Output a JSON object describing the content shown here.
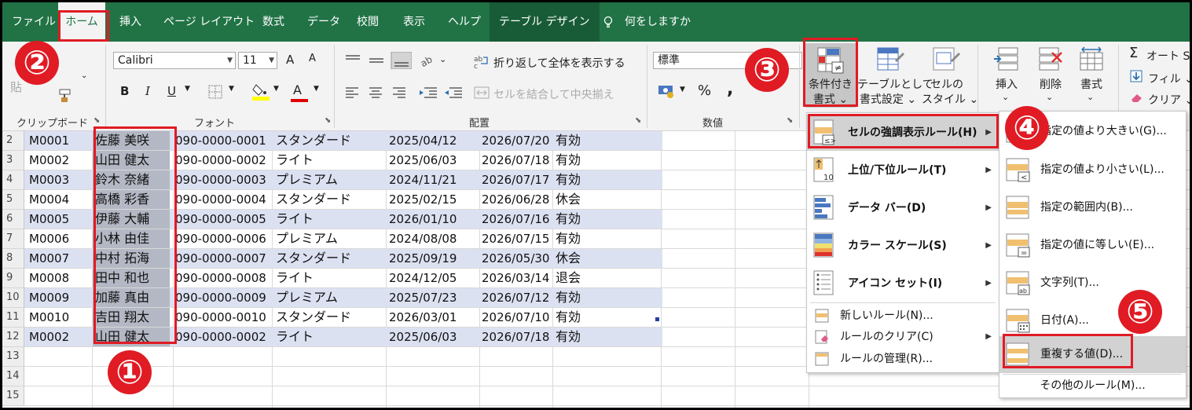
{
  "tabs": [
    "ファイル",
    "ホーム",
    "挿入",
    "ページ レイアウト",
    "数式",
    "データ",
    "校閲",
    "表示",
    "ヘルプ",
    "テーブル デザイン"
  ],
  "tell_me": "何をしますか",
  "ribbon": {
    "groups": {
      "clipboard": "クリップボード",
      "font": "フォント",
      "alignment": "配置",
      "number": "数値"
    },
    "font_name": "Calibri",
    "font_size": "11",
    "number_format": "標準",
    "wrap_text": "折り返して全体を表示する",
    "merge_center": "セルを結合して中央揃え",
    "paste_partial": "貼",
    "bold": "B",
    "italic": "I",
    "underline": "U",
    "font_grow": "A",
    "font_shrink": "A",
    "percent": "%",
    "comma": ",",
    "conditional_format": [
      "条件付き",
      "書式"
    ],
    "format_as_table": [
      "テーブルとして",
      "書式設定"
    ],
    "cell_styles": [
      "セルの",
      "スタイル"
    ],
    "insert": "挿入",
    "delete": "削除",
    "format": "書式",
    "autosum": "オート S",
    "fill": "フィル",
    "clear": "クリア"
  },
  "rows": [
    {
      "n": "2",
      "id": "M0001",
      "name": "佐藤 美咲",
      "phone": "090-0000-0001",
      "plan": "スタンダード",
      "start": "2025/04/12",
      "end": "2026/07/20",
      "status": "有効"
    },
    {
      "n": "3",
      "id": "M0002",
      "name": "山田 健太",
      "phone": "090-0000-0002",
      "plan": "ライト",
      "start": "2025/06/03",
      "end": "2026/07/18",
      "status": "有効"
    },
    {
      "n": "4",
      "id": "M0003",
      "name": "鈴木 奈緒",
      "phone": "090-0000-0003",
      "plan": "プレミアム",
      "start": "2024/11/21",
      "end": "2026/07/17",
      "status": "有効"
    },
    {
      "n": "5",
      "id": "M0004",
      "name": "高橋 彩香",
      "phone": "090-0000-0004",
      "plan": "スタンダード",
      "start": "2025/02/15",
      "end": "2026/06/28",
      "status": "休会"
    },
    {
      "n": "6",
      "id": "M0005",
      "name": "伊藤 大輔",
      "phone": "090-0000-0005",
      "plan": "ライト",
      "start": "2026/01/10",
      "end": "2026/07/16",
      "status": "有効"
    },
    {
      "n": "7",
      "id": "M0006",
      "name": "小林 由佳",
      "phone": "090-0000-0006",
      "plan": "プレミアム",
      "start": "2024/08/08",
      "end": "2026/07/15",
      "status": "有効"
    },
    {
      "n": "8",
      "id": "M0007",
      "name": "中村 拓海",
      "phone": "090-0000-0007",
      "plan": "スタンダード",
      "start": "2025/09/19",
      "end": "2026/05/30",
      "status": "休会"
    },
    {
      "n": "9",
      "id": "M0008",
      "name": "田中 和也",
      "phone": "090-0000-0008",
      "plan": "ライト",
      "start": "2024/12/05",
      "end": "2026/03/14",
      "status": "退会"
    },
    {
      "n": "10",
      "id": "M0009",
      "name": "加藤 真由",
      "phone": "090-0000-0009",
      "plan": "プレミアム",
      "start": "2025/07/23",
      "end": "2026/07/12",
      "status": "有効"
    },
    {
      "n": "11",
      "id": "M0010",
      "name": "吉田 翔太",
      "phone": "090-0000-0010",
      "plan": "スタンダード",
      "start": "2026/03/01",
      "end": "2026/07/10",
      "status": "有効"
    },
    {
      "n": "12",
      "id": "M0002",
      "name": "山田 健太",
      "phone": "090-0000-0002",
      "plan": "ライト",
      "start": "2025/06/03",
      "end": "2026/07/18",
      "status": "有効"
    }
  ],
  "empty_rows": [
    "13",
    "14",
    "15"
  ],
  "cf_menu": {
    "highlight": "セルの強調表示ルール(H)",
    "topbottom": "上位/下位ルール(T)",
    "databar": "データ バー(D)",
    "colorscale": "カラー スケール(S)",
    "iconset": "アイコン セット(I)",
    "new_rule": "新しいルール(N)...",
    "clear_rules": "ルールのクリア(C)",
    "manage_rules": "ルールの管理(R)..."
  },
  "highlight_submenu": {
    "greater": "指定の値より大きい(G)...",
    "less": "指定の値より小さい(L)...",
    "between": "指定の範囲内(B)...",
    "equal": "指定の値に等しい(E)...",
    "text": "文字列(T)...",
    "date": "日付(A)...",
    "duplicate": "重複する値(D)...",
    "more": "その他のルール(M)..."
  },
  "badges": [
    "①",
    "②",
    "③",
    "④",
    "⑤"
  ],
  "colors": {
    "excel_green": "#217346",
    "highlight_red": "#e01b24",
    "band": "#dce1f2",
    "selected": "#b4b8c4"
  }
}
